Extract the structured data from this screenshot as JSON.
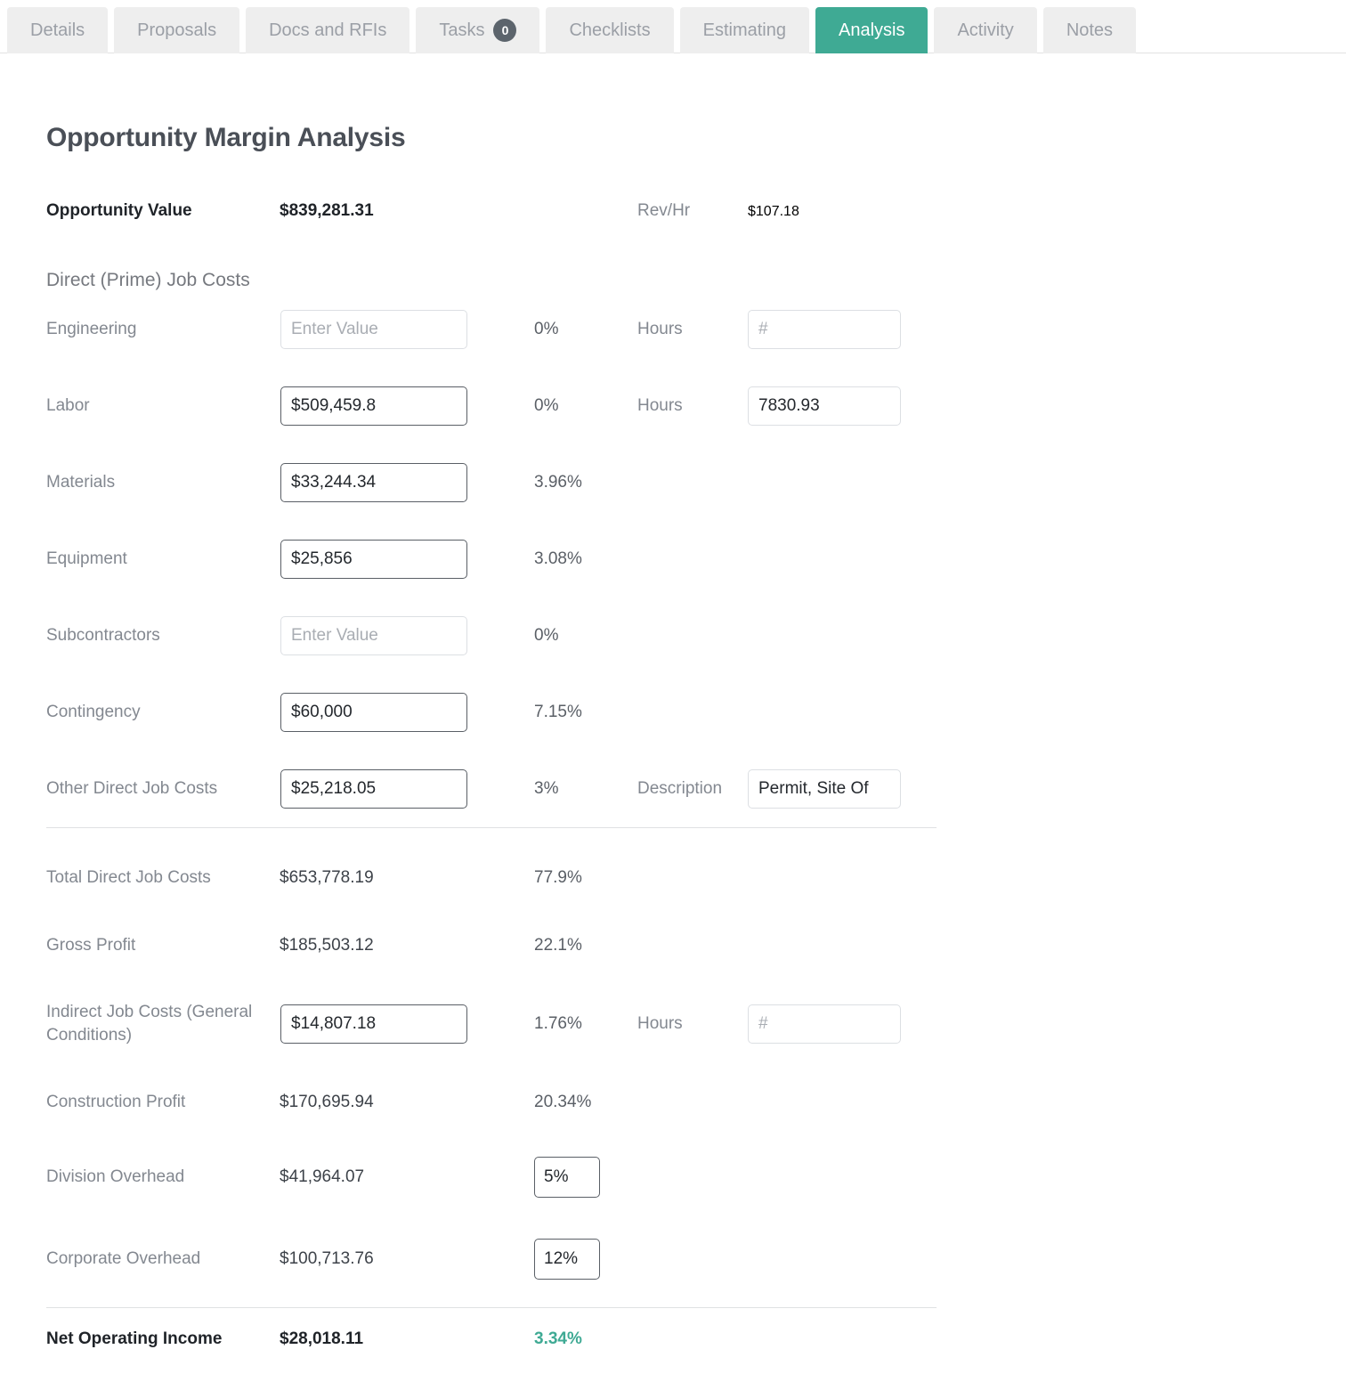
{
  "tabs": [
    {
      "label": "Details",
      "active": false,
      "badge": null
    },
    {
      "label": "Proposals",
      "active": false,
      "badge": null
    },
    {
      "label": "Docs and RFIs",
      "active": false,
      "badge": null
    },
    {
      "label": "Tasks",
      "active": false,
      "badge": "0"
    },
    {
      "label": "Checklists",
      "active": false,
      "badge": null
    },
    {
      "label": "Estimating",
      "active": false,
      "badge": null
    },
    {
      "label": "Analysis",
      "active": true,
      "badge": null
    },
    {
      "label": "Activity",
      "active": false,
      "badge": null
    },
    {
      "label": "Notes",
      "active": false,
      "badge": null
    }
  ],
  "page": {
    "title": "Opportunity Margin Analysis",
    "section_caption": "Direct (Prime) Job Costs"
  },
  "summary": {
    "opportunity_value_label": "Opportunity Value",
    "opportunity_value": "$839,281.31",
    "rev_hr_label": "Rev/Hr",
    "rev_hr_value": "$107.18"
  },
  "labels": {
    "hours": "Hours",
    "description": "Description"
  },
  "placeholders": {
    "enter_value": "Enter Value",
    "hash": "#"
  },
  "direct_costs": [
    {
      "label": "Engineering",
      "value": "",
      "placeholder": "Enter Value",
      "pct": "0%",
      "hours_label": "Hours",
      "hours_value": "",
      "hours_placeholder": "#"
    },
    {
      "label": "Labor",
      "value": "$509,459.8",
      "placeholder": "Enter Value",
      "pct": "0%",
      "hours_label": "Hours",
      "hours_value": "7830.93",
      "hours_placeholder": "#"
    },
    {
      "label": "Materials",
      "value": "$33,244.34",
      "placeholder": "Enter Value",
      "pct": "3.96%"
    },
    {
      "label": "Equipment",
      "value": "$25,856",
      "placeholder": "Enter Value",
      "pct": "3.08%"
    },
    {
      "label": "Subcontractors",
      "value": "",
      "placeholder": "Enter Value",
      "pct": "0%"
    },
    {
      "label": "Contingency",
      "value": "$60,000",
      "placeholder": "Enter Value",
      "pct": "7.15%"
    },
    {
      "label": "Other Direct Job Costs",
      "value": "$25,218.05",
      "placeholder": "Enter Value",
      "pct": "3%",
      "description_label": "Description",
      "description_value": "Permit, Site Of"
    }
  ],
  "totals": {
    "total_direct": {
      "label": "Total Direct Job Costs",
      "value": "$653,778.19",
      "pct": "77.9%"
    },
    "gross_profit": {
      "label": "Gross Profit",
      "value": "$185,503.12",
      "pct": "22.1%"
    },
    "indirect": {
      "label": "Indirect Job Costs (General Conditions)",
      "value": "$14,807.18",
      "pct": "1.76%",
      "hours_label": "Hours",
      "hours_value": "",
      "hours_placeholder": "#"
    },
    "construction_profit": {
      "label": "Construction Profit",
      "value": "$170,695.94",
      "pct": "20.34%"
    },
    "division_overhead": {
      "label": "Division Overhead",
      "value": "$41,964.07",
      "pct_value": "5%"
    },
    "corporate_overhead": {
      "label": "Corporate Overhead",
      "value": "$100,713.76",
      "pct_value": "12%"
    },
    "net_operating_income": {
      "label": "Net Operating Income",
      "value": "$28,018.11",
      "pct": "3.34%"
    }
  },
  "colors": {
    "accent_teal": "#3faa94",
    "tab_inactive_bg": "#eeeeee",
    "tab_inactive_text": "#9b9fa6",
    "badge_bg": "#5c646c",
    "label_gray": "#838890",
    "value_gray": "#3d4249"
  }
}
